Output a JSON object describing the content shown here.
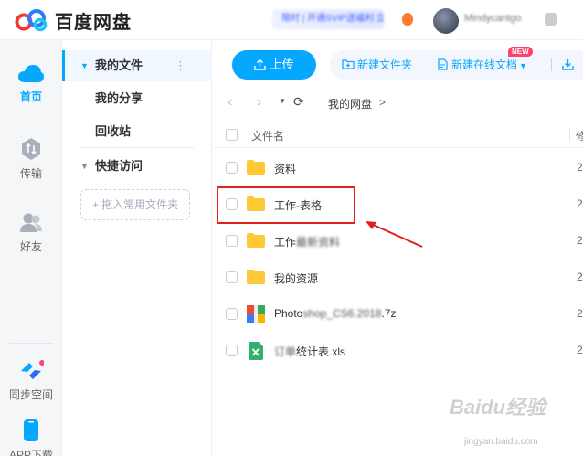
{
  "brand": {
    "name": "百度网盘"
  },
  "header": {
    "promo": "限时 | 开通SVIP送福利 立即抢购",
    "username": "Mindycantgo"
  },
  "left_nav": [
    {
      "label": "首页",
      "icon": "cloud-icon",
      "active": true
    },
    {
      "label": "传输",
      "icon": "transfer-icon"
    },
    {
      "label": "好友",
      "icon": "friends-icon"
    }
  ],
  "bottom_nav": [
    {
      "label": "同步空间",
      "icon": "sync-icon"
    },
    {
      "label": "APP下载",
      "icon": "phone-icon"
    }
  ],
  "sidebar": {
    "my_files": "我的文件",
    "my_share": "我的分享",
    "recycle": "回收站",
    "quick_access": "快捷访问",
    "drop_hint": "+ 拖入常用文件夹"
  },
  "toolbar": {
    "upload": "上传",
    "new_folder": "新建文件夹",
    "new_online_doc": "新建在线文档",
    "new_badge": "NEW"
  },
  "path": {
    "current": "我的网盘",
    "sep": ">"
  },
  "table": {
    "header_name": "文件名",
    "header_next": "修",
    "rows": [
      {
        "name": "资料",
        "type": "folder",
        "date": "2"
      },
      {
        "name": "工作-表格",
        "type": "folder",
        "date": "2"
      },
      {
        "name": "工作",
        "name_hidden": "最新资料",
        "type": "folder",
        "date": "2"
      },
      {
        "name": "我的资源",
        "type": "folder",
        "date": "2"
      },
      {
        "name_hidden_prefix": "Photo",
        "name_hidden": "shop_CS6.2018",
        "name": ".7z",
        "type": "archive",
        "date": "2"
      },
      {
        "name_hidden": "订单",
        "name": "统计表.xls",
        "type": "excel",
        "date": "2"
      }
    ]
  },
  "colors": {
    "accent": "#06a7ff",
    "highlight": "#e02020",
    "folder": "#ffc935"
  },
  "watermark": {
    "text": "Baidu经验",
    "sub": "jingyan.baidu.com"
  }
}
